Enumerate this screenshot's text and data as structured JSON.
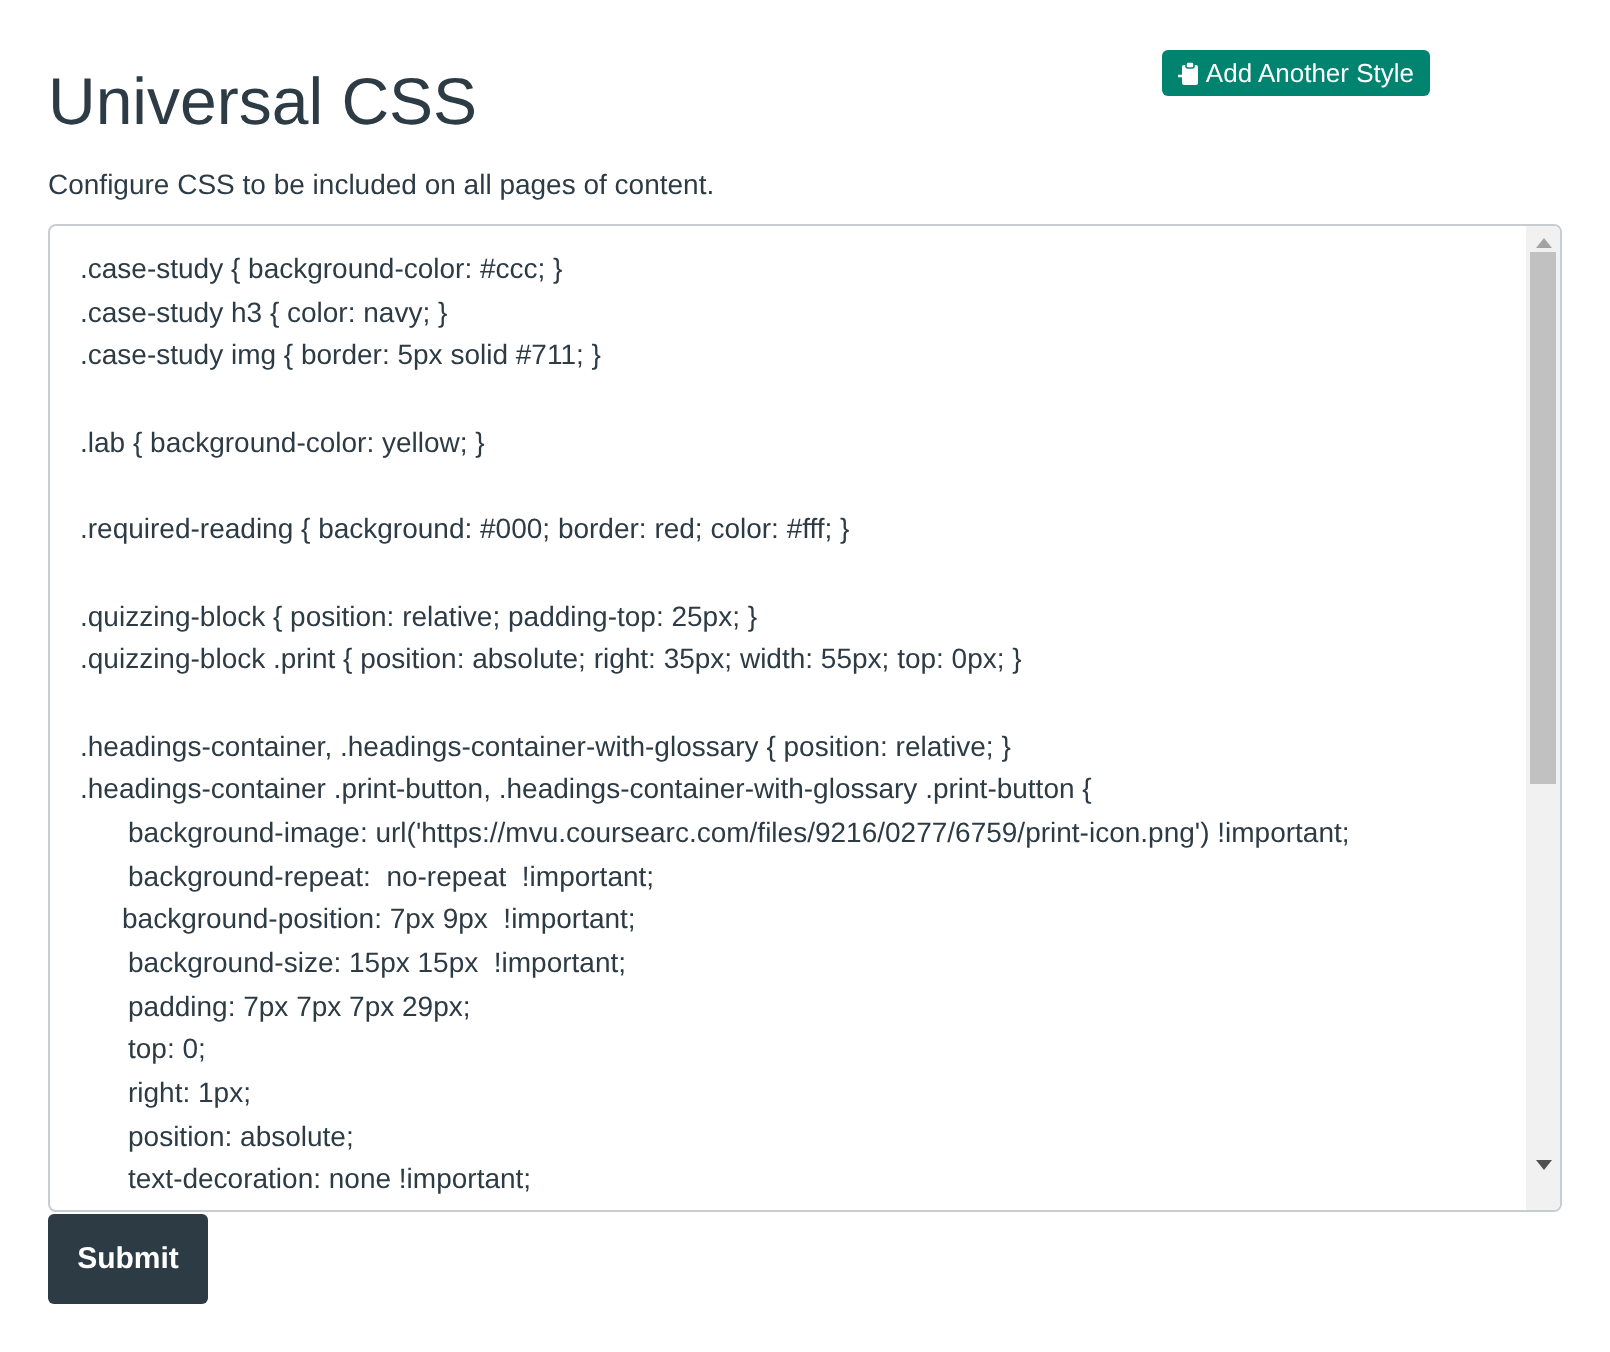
{
  "header": {
    "title": "Universal CSS",
    "add_button": "Add Another Style"
  },
  "description": "Configure CSS to be included on all pages of content.",
  "editor": {
    "lines": [
      {
        "kind": "rule",
        "text": ".case-study { background-color: #ccc; }"
      },
      {
        "kind": "rule",
        "text": ".case-study h3 { color: navy; }"
      },
      {
        "kind": "rule",
        "text": ".case-study img { border: 5px solid #711; }"
      },
      {
        "kind": "blank"
      },
      {
        "kind": "rule",
        "text": ".lab { background-color: yellow; }"
      },
      {
        "kind": "blank"
      },
      {
        "kind": "rule",
        "text": ".required-reading { background: #000; border: red; color: #fff; }"
      },
      {
        "kind": "blank"
      },
      {
        "kind": "rule",
        "text": ".quizzing-block { position: relative; padding-top: 25px; }"
      },
      {
        "kind": "rule",
        "text": ".quizzing-block .print { position: absolute; right: 35px; width: 55px; top: 0px; }"
      },
      {
        "kind": "blank"
      },
      {
        "kind": "rule",
        "text": ".headings-container, .headings-container-with-glossary { position: relative; }"
      },
      {
        "kind": "rule",
        "text": ".headings-container .print-button, .headings-container-with-glossary .print-button {"
      },
      {
        "kind": "declaration",
        "text": "background-image: url('https://mvu.coursearc.com/files/9216/0277/6759/print-icon.png') !important;"
      },
      {
        "kind": "declaration",
        "text": "background-repeat:  no-repeat  !important;"
      },
      {
        "kind": "declaration-short",
        "text": "background-position: 7px 9px  !important;"
      },
      {
        "kind": "declaration",
        "text": "background-size: 15px 15px  !important;"
      },
      {
        "kind": "declaration",
        "text": "padding: 7px 7px 7px 29px;"
      },
      {
        "kind": "declaration",
        "text": "top: 0;"
      },
      {
        "kind": "declaration",
        "text": "right: 1px;"
      },
      {
        "kind": "declaration",
        "text": "position: absolute;"
      },
      {
        "kind": "declaration",
        "text": "text-decoration: none !important;"
      }
    ]
  },
  "submit_button": "Submit"
}
